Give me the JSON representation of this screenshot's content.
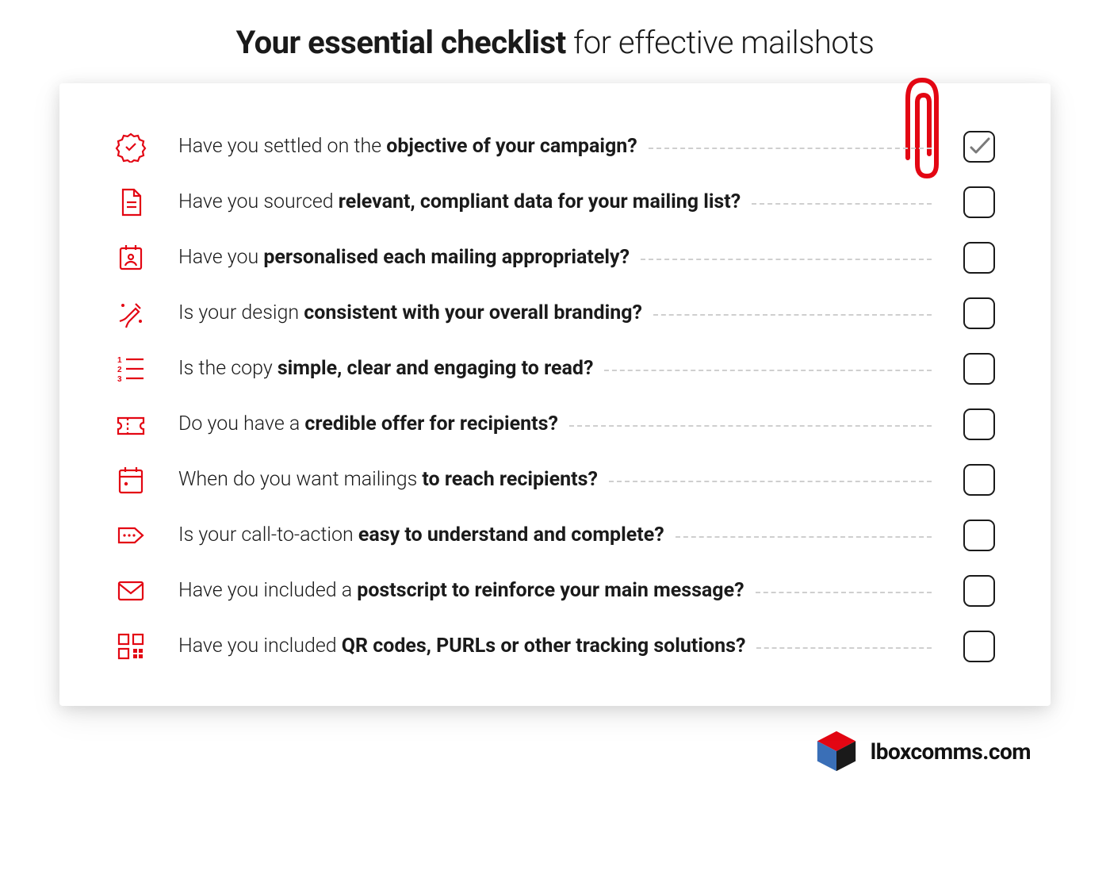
{
  "title_bold": "Your essential checklist",
  "title_rest": " for effective mailshots",
  "brand": "lboxcomms.com",
  "colors": {
    "accent": "#e30613",
    "text": "#1a1a1a",
    "dots": "#cfcfcf"
  },
  "items": [
    {
      "icon": "badge-check-icon",
      "prefix": "Have you settled on the ",
      "bold": "objective of your campaign?",
      "checked": true
    },
    {
      "icon": "document-icon",
      "prefix": "Have you sourced ",
      "bold": "relevant, compliant data for your mailing list?",
      "checked": false
    },
    {
      "icon": "contact-card-icon",
      "prefix": "Have you ",
      "bold": "personalised each mailing appropriately?",
      "checked": false
    },
    {
      "icon": "design-pen-icon",
      "prefix": "Is your design ",
      "bold": "consistent with your overall branding?",
      "checked": false
    },
    {
      "icon": "numbered-list-icon",
      "prefix": "Is the copy ",
      "bold": "simple, clear and engaging to read?",
      "checked": false
    },
    {
      "icon": "ticket-icon",
      "prefix": "Do you have a ",
      "bold": "credible offer for recipients?",
      "checked": false
    },
    {
      "icon": "calendar-icon",
      "prefix": "When do you want mailings ",
      "bold": "to reach recipients?",
      "checked": false
    },
    {
      "icon": "tag-arrow-icon",
      "prefix": "Is your call-to-action ",
      "bold": "easy to understand and complete?",
      "checked": false
    },
    {
      "icon": "envelope-icon",
      "prefix": "Have you included a ",
      "bold": "postscript to reinforce your main message?",
      "checked": false
    },
    {
      "icon": "qr-code-icon",
      "prefix": "Have you included ",
      "bold": "QR codes, PURLs or other tracking solutions?",
      "checked": false
    }
  ]
}
